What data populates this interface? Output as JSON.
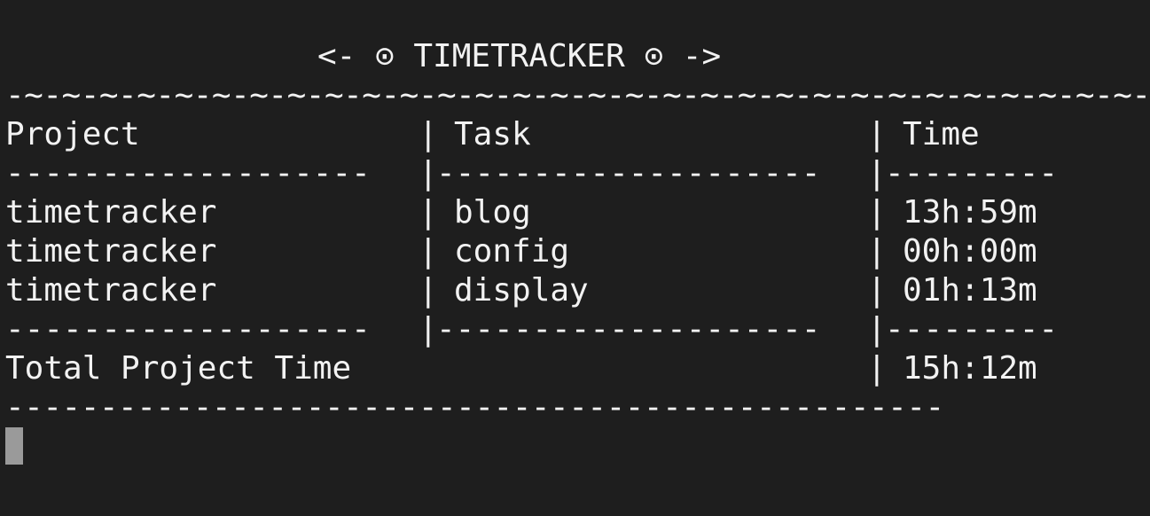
{
  "terminal": {
    "title": "<- ⊙ TIMETRACKER ⊙ ->",
    "wave_rule": "-~-~-~-~-~-~-~-~-~-~-~-~-~-~-~-~-~-~-~-~-~-~-~-~-~-~-~-~-~-~-~-~-~-~-~-~",
    "header": {
      "project": "Project",
      "task": "Task",
      "time": "Time"
    },
    "separator": "|",
    "divider_seg1": "-------------------",
    "divider_seg2": "--------------------",
    "divider_seg3": "---------",
    "rows": [
      {
        "project": "timetracker",
        "task": "blog",
        "time": "13h:59m"
      },
      {
        "project": "timetracker",
        "task": "config",
        "time": "00h:00m"
      },
      {
        "project": "timetracker",
        "task": "display",
        "time": "01h:13m"
      }
    ],
    "total": {
      "label": "Total Project Time",
      "time": "15h:12m"
    },
    "bottom_rule": "--------------------------------------------------"
  }
}
